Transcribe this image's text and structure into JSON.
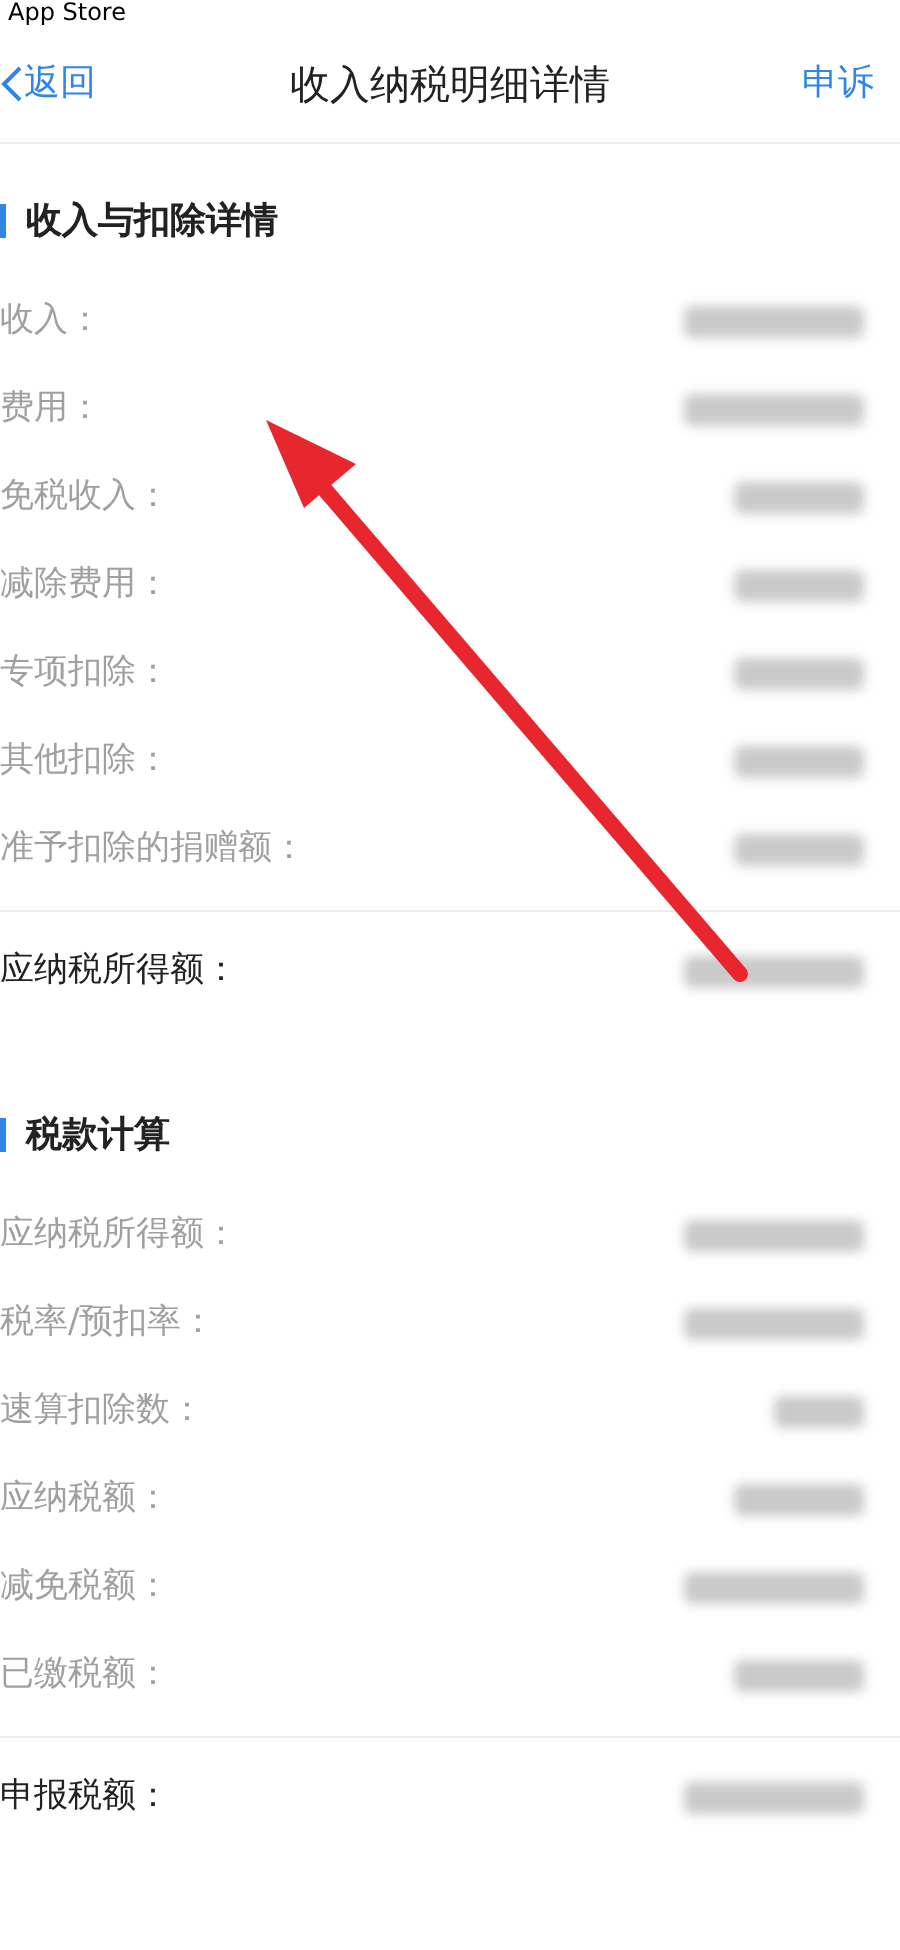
{
  "status_bar": {
    "back_app": "App Store"
  },
  "nav": {
    "back": "返回",
    "title": "收入纳税明细详情",
    "action": "申诉"
  },
  "sections": [
    {
      "title": "收入与扣除详情",
      "rows": [
        "收入：",
        "费用：",
        "免税收入：",
        "减除费用：",
        "专项扣除：",
        "其他扣除：",
        "准予扣除的捐赠额："
      ],
      "total": "应纳税所得额："
    },
    {
      "title": "税款计算",
      "rows": [
        "应纳税所得额：",
        "税率/预扣率：",
        "速算扣除数：",
        "应纳税额：",
        "减免税额：",
        "已缴税额："
      ],
      "total": "申报税额："
    }
  ]
}
